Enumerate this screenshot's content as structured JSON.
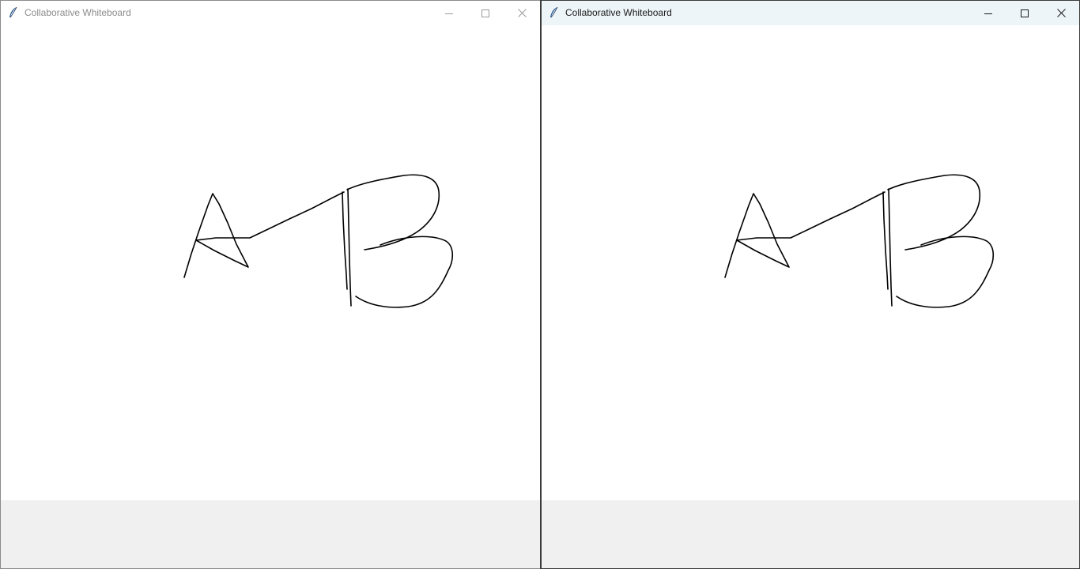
{
  "windows": [
    {
      "title": "Collaborative Whiteboard",
      "active": false
    },
    {
      "title": "Collaborative Whiteboard",
      "active": true
    }
  ],
  "colors": {
    "stroke": "#000000",
    "canvas_background": "#ffffff",
    "window_background": "#f0f0f0",
    "inactive_title_text": "#8c8c8c",
    "active_title_text": "#1a1a1a"
  },
  "icons": {
    "app": "feather-icon",
    "minimize": "minimize-icon",
    "maximize": "maximize-icon",
    "close": "close-icon"
  }
}
